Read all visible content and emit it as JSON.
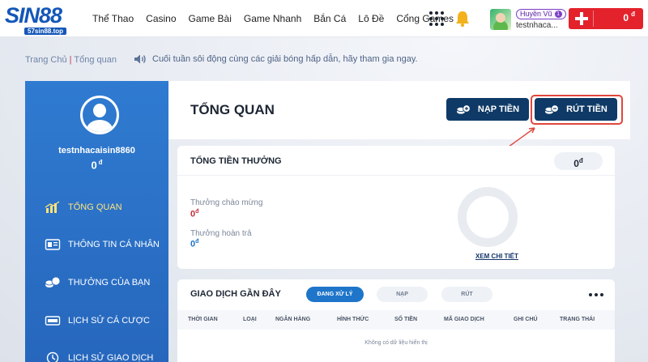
{
  "brand": {
    "logo": "SIN88",
    "domain": "57sin88.top"
  },
  "nav": [
    "Thể Thao",
    "Casino",
    "Game Bài",
    "Game Nhanh",
    "Bắn Cá",
    "Lô Đề",
    "Cổng Games"
  ],
  "user": {
    "display_name": "Huyền Vũ",
    "level": "1",
    "short_name": "testnhaca...",
    "balance": "0",
    "currency": "đ"
  },
  "breadcrumb": {
    "home": "Trang Chủ",
    "current": "Tổng quan"
  },
  "announcement": "Cuối tuần sôi động cùng các giải bóng hấp dẫn, hãy tham gia ngay.",
  "sidebar": {
    "username": "testnhacaisin8860",
    "balance": "0",
    "currency": "đ",
    "items": [
      {
        "label": "Tổng quan",
        "icon": "chart-icon"
      },
      {
        "label": "Thông tin cá nhân",
        "icon": "id-card-icon"
      },
      {
        "label": "Thưởng của bạn",
        "icon": "coins-icon"
      },
      {
        "label": "Lịch sử cá cược",
        "icon": "ticket-icon"
      },
      {
        "label": "Lịch sử giao dịch",
        "icon": "clock-icon"
      }
    ]
  },
  "main": {
    "title": "TỔNG QUAN",
    "deposit_label": "NẠP TIỀN",
    "withdraw_label": "RÚT TIỀN"
  },
  "bonus": {
    "title": "Tổng tiền thưởng",
    "total": "0",
    "currency": "đ",
    "welcome_label": "Thưởng chào mừng",
    "welcome_value": "0",
    "rebate_label": "Thưởng hoàn trả",
    "rebate_value": "0",
    "detail_link": "XEM CHI TIẾT"
  },
  "transactions": {
    "title": "Giao dịch gần đây",
    "tabs": [
      "Đang xử lý",
      "Nạp",
      "Rút"
    ],
    "columns": [
      "Thời gian",
      "Loại",
      "Ngân hàng",
      "Hình thức",
      "Số tiền",
      "Mã giao dịch",
      "Ghi chú",
      "Trạng thái"
    ],
    "empty_text": "Không có dữ liệu hiển thị"
  },
  "colors": {
    "primary_blue": "#2f7bd1",
    "dark_navy": "#0f3a67",
    "accent_red": "#e3222c",
    "highlight": "#ffe47a"
  }
}
